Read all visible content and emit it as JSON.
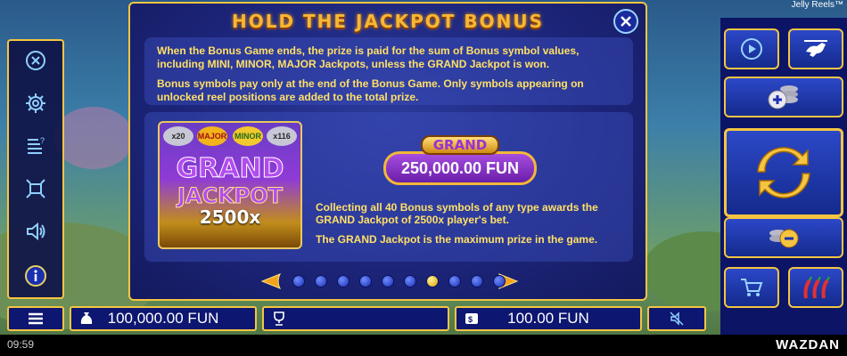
{
  "game_title": "Jelly Reels™",
  "left_menu": {
    "items": [
      {
        "icon": "close-icon"
      },
      {
        "icon": "settings-icon"
      },
      {
        "icon": "paytable-icon"
      },
      {
        "icon": "fullscreen-icon"
      },
      {
        "icon": "sound-icon"
      },
      {
        "icon": "info-icon"
      }
    ]
  },
  "panel": {
    "title": "HOLD THE JACKPOT BONUS",
    "paragraph1": "When the Bonus Game ends, the prize is paid for the sum of Bonus symbol values, including MINI, MINOR, MAJOR Jackpots, unless the GRAND Jackpot is won.",
    "paragraph2": "Bonus symbols pay only at the end of the Bonus Game. Only symbols appearing on unlocked reel positions are added to the total prize.",
    "image": {
      "coins": [
        "x20",
        "MAJOR",
        "MINOR",
        "x116"
      ],
      "line1": "GRAND",
      "line2": "JACKPOT",
      "line3": "2500x"
    },
    "badge": {
      "label": "GRAND",
      "value": "250,000.00 FUN"
    },
    "paragraph3": "Collecting all 40 Bonus symbols of any type awards the GRAND Jackpot of 2500x player's bet.",
    "paragraph4": "The GRAND Jackpot is the maximum prize in the game.",
    "pager": {
      "total": 10,
      "active": 6
    }
  },
  "bottom_bar": {
    "balance": "100,000.00 FUN",
    "win": "",
    "bet": "100.00 FUN"
  },
  "status": {
    "time": "09:59",
    "brand": "WAZDAN"
  },
  "colors": {
    "gold": "#f5c542",
    "panel": "#1c2478",
    "text_yellow": "#ffe066"
  }
}
